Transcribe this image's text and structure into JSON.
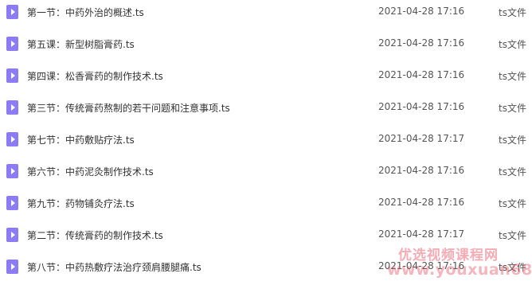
{
  "files": [
    {
      "name": "第一节：中药外治的概述.ts",
      "date": "2021-04-28 17:16",
      "type": "ts文件",
      "icon": "video-file-icon"
    },
    {
      "name": "第五课：新型树脂膏药.ts",
      "date": "2021-04-28 17:16",
      "type": "ts文件",
      "icon": "video-file-icon"
    },
    {
      "name": "第四课：松香膏药的制作技术.ts",
      "date": "2021-04-28 17:16",
      "type": "ts文件",
      "icon": "video-file-icon"
    },
    {
      "name": "第三节：传统膏药熬制的若干问题和注意事项.ts",
      "date": "2021-04-28 17:16",
      "type": "ts文件",
      "icon": "video-file-icon"
    },
    {
      "name": "第七节：中药敷贴疗法.ts",
      "date": "2021-04-28 17:17",
      "type": "ts文件",
      "icon": "video-file-icon"
    },
    {
      "name": "第六节：中药泥灸制作技术.ts",
      "date": "2021-04-28 17:16",
      "type": "ts文件",
      "icon": "video-file-icon"
    },
    {
      "name": "第九节：药物铺灸疗法.ts",
      "date": "2021-04-28 17:16",
      "type": "ts文件",
      "icon": "video-file-icon"
    },
    {
      "name": "第二节：传统膏药的制作技术.ts",
      "date": "2021-04-28 17:17",
      "type": "ts文件",
      "icon": "video-file-icon"
    },
    {
      "name": "第八节：中药热敷疗法治疗颈肩腰腿痛.ts",
      "date": "2021-04-28 17:16",
      "type": "ts文件",
      "icon": "video-file-icon"
    }
  ],
  "watermark": {
    "line1": "优选视频课程网",
    "line2": "www.youxuan68.com"
  },
  "colors": {
    "icon": "#8b7cf5",
    "text": "#333333",
    "watermark": "#e6465a"
  }
}
